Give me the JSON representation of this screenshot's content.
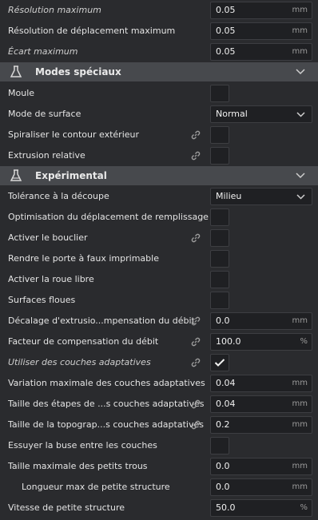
{
  "rows_top": [
    {
      "label": "Résolution maximum",
      "value": "0.05",
      "unit": "mm",
      "italic": true
    },
    {
      "label": "Résolution de déplacement maximum",
      "value": "0.05",
      "unit": "mm"
    },
    {
      "label": "Écart maximum",
      "value": "0.05",
      "unit": "mm",
      "italic": true
    }
  ],
  "section_special": {
    "title": "Modes spéciaux",
    "icon": "flask-icon"
  },
  "special": {
    "moule": {
      "label": "Moule"
    },
    "surface_mode": {
      "label": "Mode de surface",
      "value": "Normal"
    },
    "spiralize": {
      "label": "Spiraliser le contour extérieur"
    },
    "relative_extrusion": {
      "label": "Extrusion relative"
    }
  },
  "section_experimental": {
    "title": "Expérimental",
    "icon": "flask-icon"
  },
  "experimental": {
    "slicing_tolerance": {
      "label": "Tolérance à la découpe",
      "value": "Milieu"
    },
    "infill_travel_opt": {
      "label": "Optimisation du déplacement de remplissage"
    },
    "shield": {
      "label": "Activer le bouclier"
    },
    "overhang": {
      "label": "Rendre le porte à faux imprimable"
    },
    "coasting": {
      "label": "Activer la roue libre"
    },
    "fuzzy": {
      "label": "Surfaces floues"
    },
    "flow_offset": {
      "label": "Décalage d'extrusio...mpensation du débit",
      "value": "0.0",
      "unit": "mm"
    },
    "flow_factor": {
      "label": "Facteur de compensation du débit",
      "value": "100.0",
      "unit": "%"
    },
    "adaptive_layers": {
      "label": "Utiliser des couches adaptatives",
      "checked": true
    },
    "adaptive_var": {
      "label": "Variation maximale des couches adaptatives",
      "value": "0.04",
      "unit": "mm"
    },
    "adaptive_step": {
      "label": "Taille des étapes de ...s couches adaptatives",
      "value": "0.04",
      "unit": "mm"
    },
    "adaptive_topo": {
      "label": "Taille de la topograp...s couches adaptatives",
      "value": "0.2",
      "unit": "mm"
    },
    "wipe_nozzle": {
      "label": "Essuyer la buse entre les couches"
    },
    "small_hole": {
      "label": "Taille maximale des petits trous",
      "value": "0.0",
      "unit": "mm"
    },
    "small_feature_len": {
      "label": "Longueur max de petite structure",
      "value": "0.0",
      "unit": "mm"
    },
    "small_feature_speed": {
      "label": "Vitesse de petite structure",
      "value": "50.0",
      "unit": "%"
    }
  },
  "colors": {
    "background": "#2a2b2e",
    "section": "#47494d",
    "field": "#1f2023"
  }
}
